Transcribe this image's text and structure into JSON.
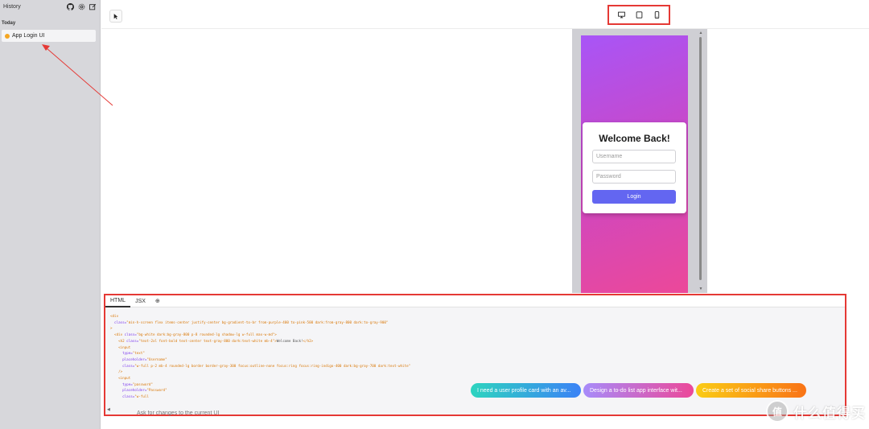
{
  "sidebar": {
    "title": "History",
    "group_label": "Today",
    "items": [
      {
        "label": "App Login UI"
      }
    ]
  },
  "toolbar": {
    "devices": [
      "desktop-icon",
      "tablet-icon",
      "mobile-icon"
    ]
  },
  "preview": {
    "card_title": "Welcome Back!",
    "username_placeholder": "Username",
    "password_placeholder": "Password",
    "login_label": "Login"
  },
  "code_panel": {
    "tabs": [
      "HTML",
      "JSX"
    ],
    "add_tab": "⊕",
    "lines": [
      [
        {
          "t": "tag",
          "v": "<div"
        }
      ],
      [
        {
          "t": "attr",
          "v": "  class="
        },
        {
          "t": "str",
          "v": "\"min-h-screen flex items-center justify-center bg-gradient-to-br from-purple-400 to-pink-500 dark:from-gray-800 dark:to-gray-900\""
        }
      ],
      [
        {
          "t": "tag",
          "v": ">"
        }
      ],
      [
        {
          "t": "tag",
          "v": "  <div "
        },
        {
          "t": "attr",
          "v": "class="
        },
        {
          "t": "str",
          "v": "\"bg-white dark:bg-gray-800 p-8 rounded-lg shadow-lg w-full max-w-md\""
        },
        {
          "t": "tag",
          "v": ">"
        }
      ],
      [
        {
          "t": "tag",
          "v": "    <h2 "
        },
        {
          "t": "attr",
          "v": "class="
        },
        {
          "t": "str",
          "v": "\"text-2xl font-bold text-center text-gray-800 dark:text-white mb-4\""
        },
        {
          "t": "tag",
          "v": ">"
        },
        {
          "t": "text",
          "v": "Welcome Back!"
        },
        {
          "t": "tag",
          "v": "</h2>"
        }
      ],
      [
        {
          "t": "tag",
          "v": "    <input"
        }
      ],
      [
        {
          "t": "attr",
          "v": "      type="
        },
        {
          "t": "str",
          "v": "\"text\""
        }
      ],
      [
        {
          "t": "attr",
          "v": "      placeholder="
        },
        {
          "t": "str",
          "v": "\"Username\""
        }
      ],
      [
        {
          "t": "attr",
          "v": "      class="
        },
        {
          "t": "str",
          "v": "\"w-full p-2 mb-4 rounded-lg border border-gray-300 focus:outline-none focus:ring focus:ring-indigo-400 dark:bg-gray-700 dark:text-white\""
        }
      ],
      [
        {
          "t": "tag",
          "v": "    />"
        }
      ],
      [
        {
          "t": "tag",
          "v": "    <input"
        }
      ],
      [
        {
          "t": "attr",
          "v": "      type="
        },
        {
          "t": "str",
          "v": "\"password\""
        }
      ],
      [
        {
          "t": "attr",
          "v": "      placeholder="
        },
        {
          "t": "str",
          "v": "\"Password\""
        }
      ],
      [
        {
          "t": "attr",
          "v": "      class="
        },
        {
          "t": "str",
          "v": "\"w-full"
        }
      ]
    ]
  },
  "suggestions": [
    "I need a user profile card with an av...",
    "Design a to-do list app interface wit...",
    "Create a set of social share buttons ..."
  ],
  "prompt": {
    "placeholder": "Ask for changes to the current UI"
  },
  "watermark": {
    "badge": "值",
    "text": "什么值得买"
  },
  "colors": {
    "accent": "#6366f1",
    "highlight": "#e53935"
  }
}
